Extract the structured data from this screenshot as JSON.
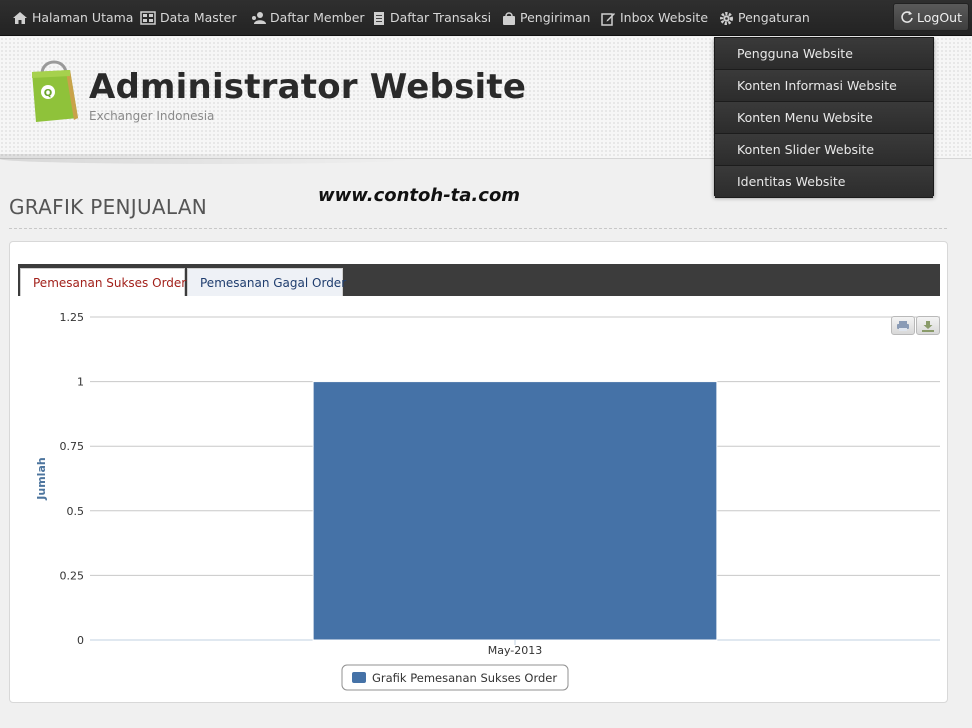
{
  "nav": {
    "items": [
      {
        "label": "Halaman Utama",
        "icon": "home-icon"
      },
      {
        "label": "Data Master",
        "icon": "database-icon"
      },
      {
        "label": "Daftar Member",
        "icon": "users-icon"
      },
      {
        "label": "Daftar Transaksi",
        "icon": "document-icon"
      },
      {
        "label": "Pengiriman",
        "icon": "bag-icon"
      },
      {
        "label": "Inbox Website",
        "icon": "edit-icon"
      },
      {
        "label": "Pengaturan",
        "icon": "gear-icon"
      }
    ],
    "logout_label": "LogOut"
  },
  "header": {
    "title": "Administrator Website",
    "subtitle": "Exchanger Indonesia"
  },
  "dropdown": {
    "items": [
      "Pengguna Website",
      "Konten Informasi Website",
      "Konten Menu Website",
      "Konten Slider Website",
      "Identitas Website"
    ]
  },
  "watermark": "www.contoh-ta.com",
  "page_title": "GRAFIK PENJUALAN",
  "tabs": [
    {
      "label": "Pemesanan Sukses Order",
      "active": true
    },
    {
      "label": "Pemesanan Gagal Order",
      "active": false
    }
  ],
  "colors": {
    "bar": "#4572a7",
    "active_tab_text": "#a2211b",
    "inactive_tab_text": "#1f3d6e",
    "navbar": "#2a2a2a"
  },
  "chart_data": {
    "type": "bar",
    "categories": [
      "May-2013"
    ],
    "series": [
      {
        "name": "Grafik Pemesanan Sukses Order",
        "values": [
          1
        ]
      }
    ],
    "ylabel": "Jumlah",
    "ylim": [
      0,
      1.25
    ],
    "yticks": [
      "0",
      "0.25",
      "0.5",
      "0.75",
      "1",
      "1.25"
    ],
    "grid": true,
    "legend": "bottom-center"
  }
}
